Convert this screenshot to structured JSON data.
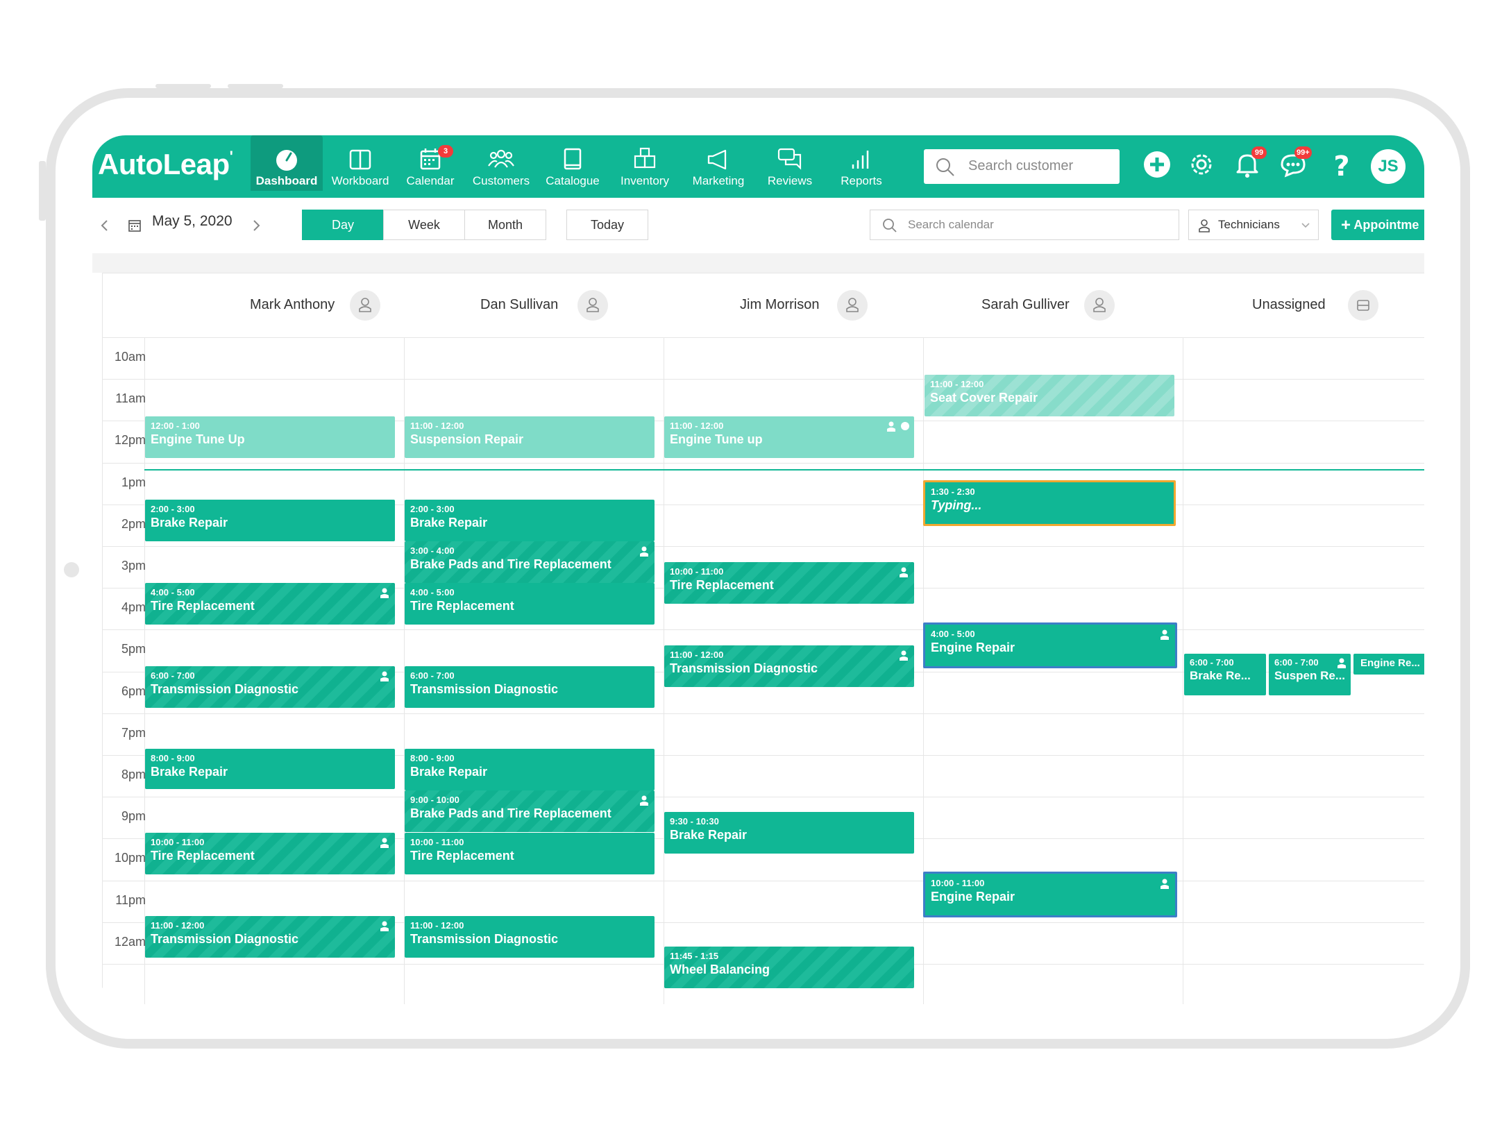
{
  "app": {
    "logo": "AutoLeap",
    "brand_color": "#10b795"
  },
  "nav": [
    {
      "label": "Dashboard",
      "icon": "dashboard-gauge-icon",
      "active": true
    },
    {
      "label": "Workboard",
      "icon": "workboard-columns-icon"
    },
    {
      "label": "Calendar",
      "icon": "calendar-icon",
      "badge": "3"
    },
    {
      "label": "Customers",
      "icon": "customers-group-icon"
    },
    {
      "label": "Catalogue",
      "icon": "catalogue-book-icon"
    },
    {
      "label": "Inventory",
      "icon": "inventory-boxes-icon"
    },
    {
      "label": "Marketing",
      "icon": "marketing-megaphone-icon"
    },
    {
      "label": "Reviews",
      "icon": "reviews-chat-icon"
    },
    {
      "label": "Reports",
      "icon": "reports-bars-icon"
    }
  ],
  "header": {
    "search_placeholder": "Search customer",
    "notifications_badge": "99",
    "messages_badge": "99+",
    "avatar_initials": "JS"
  },
  "toolbar": {
    "date": "May 5, 2020",
    "views": [
      "Day",
      "Week",
      "Month"
    ],
    "active_view": "Day",
    "today_label": "Today",
    "search_placeholder": "Search calendar",
    "technicians_label": "Technicians",
    "appointment_label": "Appointme"
  },
  "columns": [
    "Mark Anthony",
    "Dan Sullivan",
    "Jim Morrison",
    "Sarah Gulliver",
    "Unassigned"
  ],
  "hours": [
    "10am",
    "11am",
    "12pm",
    "1pm",
    "2pm",
    "3pm",
    "4pm",
    "5pm",
    "6pm",
    "7pm",
    "8pm",
    "9pm",
    "10pm",
    "11pm",
    "12am"
  ],
  "events": {
    "mark": [
      {
        "time": "12:00 - 1:00",
        "title": "Engine Tune Up"
      },
      {
        "time": "2:00 - 3:00",
        "title": "Brake Repair"
      },
      {
        "time": "4:00 - 5:00",
        "title": "Tire Replacement"
      },
      {
        "time": "6:00 - 7:00",
        "title": "Transmission Diagnostic"
      },
      {
        "time": "8:00 - 9:00",
        "title": "Brake Repair"
      },
      {
        "time": "10:00 - 11:00",
        "title": "Tire Replacement"
      },
      {
        "time": "11:00 - 12:00",
        "title": "Transmission Diagnostic"
      }
    ],
    "dan": [
      {
        "time": "11:00 - 12:00",
        "title": "Suspension Repair"
      },
      {
        "time": "2:00 - 3:00",
        "title": "Brake Repair"
      },
      {
        "time": "3:00 - 4:00",
        "title": "Brake Pads and Tire Replacement"
      },
      {
        "time": "4:00 - 5:00",
        "title": "Tire Replacement"
      },
      {
        "time": "6:00 - 7:00",
        "title": "Transmission Diagnostic"
      },
      {
        "time": "8:00 - 9:00",
        "title": "Brake Repair"
      },
      {
        "time": "9:00 - 10:00",
        "title": "Brake Pads and Tire Replacement"
      },
      {
        "time": "10:00 - 11:00",
        "title": "Tire Replacement"
      },
      {
        "time": "11:00 - 12:00",
        "title": "Transmission Diagnostic"
      }
    ],
    "jim": [
      {
        "time": "11:00 - 12:00",
        "title": "Engine Tune up"
      },
      {
        "time": "10:00 - 11:00",
        "title": "Tire Replacement"
      },
      {
        "time": "11:00 - 12:00",
        "title": "Transmission Diagnostic"
      },
      {
        "time": "9:30 - 10:30",
        "title": "Brake Repair"
      },
      {
        "time": "11:45 - 1:15",
        "title": "Wheel Balancing"
      }
    ],
    "sarah": [
      {
        "time": "11:00 - 12:00",
        "title": "Seat Cover Repair"
      },
      {
        "time": "1:30 - 2:30",
        "title": "Typing..."
      },
      {
        "time": "4:00 - 5:00",
        "title": "Engine Repair"
      },
      {
        "time": "10:00 - 11:00",
        "title": "Engine Repair"
      }
    ],
    "unassigned": [
      {
        "time": "6:00 - 7:00",
        "title": "Brake Re..."
      },
      {
        "time": "6:00 - 7:00",
        "title": "Suspen Re..."
      },
      {
        "time": "",
        "title": "Engine Re..."
      }
    ]
  }
}
